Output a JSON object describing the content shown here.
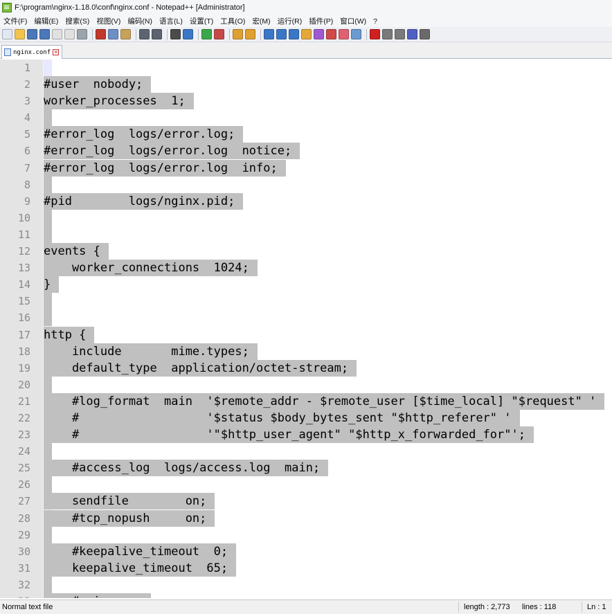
{
  "window": {
    "title": "F:\\program\\nginx-1.18.0\\conf\\nginx.conf - Notepad++ [Administrator]"
  },
  "menu": [
    "文件(F)",
    "编辑(E)",
    "搜索(S)",
    "视图(V)",
    "编码(N)",
    "语言(L)",
    "设置(T)",
    "工具(O)",
    "宏(M)",
    "运行(R)",
    "插件(P)",
    "窗口(W)",
    "?"
  ],
  "toolbar": {
    "buttons": [
      {
        "icon": "new-file-icon",
        "color": "#dfe8f3"
      },
      {
        "icon": "open-file-icon",
        "color": "#f2c44e"
      },
      {
        "icon": "save-icon",
        "color": "#4a78b8"
      },
      {
        "icon": "save-all-icon",
        "color": "#4a78b8"
      },
      {
        "icon": "close-icon",
        "color": "#e0e0e0"
      },
      {
        "icon": "close-all-icon",
        "color": "#e0e0e0"
      },
      {
        "icon": "print-icon",
        "color": "#9aa4ad"
      },
      "sep",
      {
        "icon": "cut-icon",
        "color": "#c0392b"
      },
      {
        "icon": "copy-icon",
        "color": "#6c8fc4"
      },
      {
        "icon": "paste-icon",
        "color": "#c9a25a"
      },
      "sep",
      {
        "icon": "undo-icon",
        "color": "#5b6470"
      },
      {
        "icon": "redo-icon",
        "color": "#5b6470"
      },
      "sep",
      {
        "icon": "find-icon",
        "color": "#4b4b4b"
      },
      {
        "icon": "replace-icon",
        "color": "#3b77c7"
      },
      "sep",
      {
        "icon": "zoom-in-icon",
        "color": "#3aa84a"
      },
      {
        "icon": "zoom-out-icon",
        "color": "#c44a4a"
      },
      "sep",
      {
        "icon": "sync-vertical-icon",
        "color": "#e0a030"
      },
      {
        "icon": "sync-horizontal-icon",
        "color": "#e0a030"
      },
      "sep",
      {
        "icon": "word-wrap-icon",
        "color": "#3b77c7"
      },
      {
        "icon": "show-all-chars-icon",
        "color": "#3b77c7"
      },
      {
        "icon": "indent-guide-icon",
        "color": "#3b77c7"
      },
      {
        "icon": "udl-icon",
        "color": "#e4a83a"
      },
      {
        "icon": "doc-map-icon",
        "color": "#a05ad0"
      },
      {
        "icon": "function-list-icon",
        "color": "#d04a4a"
      },
      {
        "icon": "folder-workspace-icon",
        "color": "#e06070"
      },
      {
        "icon": "monitoring-icon",
        "color": "#6a9ad0"
      },
      "sep",
      {
        "icon": "record-macro-icon",
        "color": "#d02020"
      },
      {
        "icon": "stop-macro-icon",
        "color": "#7a7a7a"
      },
      {
        "icon": "play-macro-icon",
        "color": "#7a7a7a"
      },
      {
        "icon": "run-macro-multiple-icon",
        "color": "#5060c0"
      },
      {
        "icon": "save-macro-icon",
        "color": "#6a6a6a"
      }
    ]
  },
  "tabs": [
    {
      "label": "nginx.conf"
    }
  ],
  "editor": {
    "current_line": 1,
    "lines": [
      "",
      "#user  nobody;",
      "worker_processes  1;",
      "",
      "#error_log  logs/error.log;",
      "#error_log  logs/error.log  notice;",
      "#error_log  logs/error.log  info;",
      "",
      "#pid        logs/nginx.pid;",
      "",
      "",
      "events {",
      "    worker_connections  1024;",
      "}",
      "",
      "",
      "http {",
      "    include       mime.types;",
      "    default_type  application/octet-stream;",
      "",
      "    #log_format  main  '$remote_addr - $remote_user [$time_local] \"$request\" '",
      "    #                  '$status $body_bytes_sent \"$http_referer\" '",
      "    #                  '\"$http_user_agent\" \"$http_x_forwarded_for\"';",
      "",
      "    #access_log  logs/access.log  main;",
      "",
      "    sendfile        on;",
      "    #tcp_nopush     on;",
      "",
      "    #keepalive_timeout  0;",
      "    keepalive_timeout  65;",
      "",
      "    #gzip  on;"
    ]
  },
  "status": {
    "mode": "Normal text file",
    "length": "length : 2,773",
    "lines": "lines : 118",
    "position": "Ln : 1"
  }
}
